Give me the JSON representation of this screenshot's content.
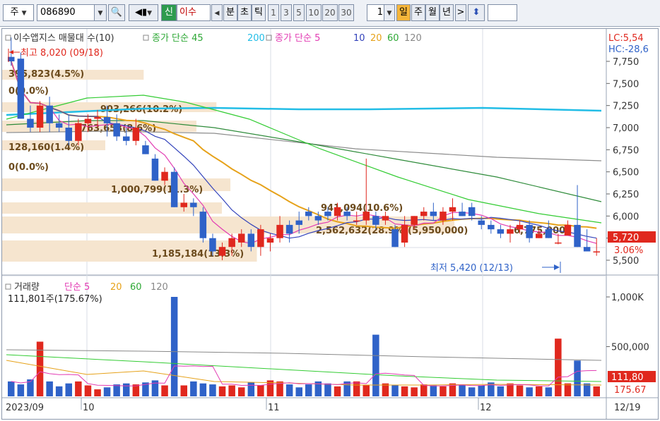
{
  "toolbar": {
    "market": "주",
    "code": "086890",
    "badge": "신",
    "name": "이수",
    "unit_min": "분",
    "unit_sec": "초",
    "unit_tick": "틱",
    "periods": [
      "1",
      "3",
      "5",
      "10",
      "20",
      "30"
    ],
    "count": "1",
    "day": "일",
    "week": "주",
    "month": "월",
    "year": "년",
    "next": ">",
    "updown": "⬍"
  },
  "price_legend": {
    "item1": "이수앱지스 매물대 수(10)",
    "item2": "종가 단순 45",
    "item2b": "200",
    "item3": "종가 단순 5",
    "mas": [
      "10",
      "20",
      "60",
      "120"
    ]
  },
  "right_top": {
    "lc": "LC:5,54",
    "hc": "HC:-28,6"
  },
  "price_axis": [
    "7,750",
    "7,500",
    "7,250",
    "7,000",
    "6,750",
    "6,500",
    "6,250",
    "6,000",
    "5,750",
    "5,500"
  ],
  "current_price": "5,720",
  "current_change": "3.06%",
  "annotations": {
    "high": "최고 8,020 (09/18)",
    "low": "최저 5,420 (12/13)"
  },
  "profile_labels": [
    "395,823(4.5%)",
    "0(0.0%)",
    "903,266(10.2%)",
    "763,653(8.6%)",
    "128,160(1.4%)",
    "0(0.0%)",
    "1,000,799(11.3%)",
    "941,094(10.6%)",
    "2,562,632(28.9%)(5,950,000)",
    "1,185,184(13.3%)",
    "6,775,000"
  ],
  "volume_legend": {
    "title": "거래량",
    "ma": "단순 5",
    "mas": [
      "20",
      "60",
      "120"
    ],
    "current": "111,801주(175.67%)"
  },
  "volume_axis": [
    "1,000K",
    "500,000"
  ],
  "volume_badge": {
    "value": "111,80",
    "pct": "175.67"
  },
  "date_axis": {
    "labels": [
      "2023/09",
      "10",
      "11",
      "12",
      "12/19"
    ]
  },
  "colors": {
    "up": "#e0281e",
    "down": "#2f62c8",
    "ma5": "#e23cb3",
    "ma10": "#3343bb",
    "ma20": "#e6a21a",
    "ma60": "#33cc33",
    "ma120": "#8c8c8c",
    "ma200": "#22bde6",
    "ma45": "#2e8b3a",
    "profile": "#f6e5cf"
  },
  "chart_data": {
    "type": "candlestick",
    "y_range": [
      5400,
      8050
    ],
    "volume_range": [
      0,
      1050000
    ],
    "dates": [
      "09/18",
      "09/19",
      "09/20",
      "09/21",
      "09/22",
      "09/25",
      "09/26",
      "09/27",
      "10/04",
      "10/05",
      "10/06",
      "10/10",
      "10/11",
      "10/12",
      "10/13",
      "10/16",
      "10/17",
      "10/18",
      "10/19",
      "10/20",
      "10/23",
      "10/24",
      "10/25",
      "10/26",
      "10/27",
      "10/30",
      "10/31",
      "11/01",
      "11/02",
      "11/03",
      "11/06",
      "11/07",
      "11/08",
      "11/09",
      "11/10",
      "11/13",
      "11/14",
      "11/15",
      "11/16",
      "11/17",
      "11/20",
      "11/21",
      "11/22",
      "11/23",
      "11/24",
      "11/27",
      "11/28",
      "11/29",
      "11/30",
      "12/01",
      "12/04",
      "12/05",
      "12/06",
      "12/07",
      "12/08",
      "12/11",
      "12/12",
      "12/13",
      "12/14",
      "12/15",
      "12/18",
      "12/19"
    ],
    "ohlc": [
      [
        7800,
        8020,
        7700,
        7750
      ],
      [
        7780,
        7850,
        7200,
        7100
      ],
      [
        7100,
        7250,
        6950,
        7000
      ],
      [
        7000,
        7300,
        6950,
        7250
      ],
      [
        7250,
        7350,
        6950,
        7050
      ],
      [
        7050,
        7150,
        6950,
        7000
      ],
      [
        7000,
        7150,
        6800,
        6850
      ],
      [
        6850,
        7100,
        6800,
        7050
      ],
      [
        7050,
        7150,
        6950,
        7100
      ],
      [
        7100,
        7200,
        7000,
        7120
      ],
      [
        7120,
        7250,
        6900,
        7050
      ],
      [
        7050,
        7150,
        6850,
        6900
      ],
      [
        6900,
        7000,
        6800,
        6850
      ],
      [
        6850,
        7100,
        6800,
        7000
      ],
      [
        6800,
        6850,
        6700,
        6700
      ],
      [
        6650,
        6700,
        6400,
        6400
      ],
      [
        6400,
        6550,
        6350,
        6500
      ],
      [
        6500,
        6550,
        6100,
        6100
      ],
      [
        6100,
        6250,
        6050,
        6150
      ],
      [
        6150,
        6200,
        6000,
        6100
      ],
      [
        6050,
        6100,
        5700,
        5750
      ],
      [
        5750,
        5800,
        5550,
        5600
      ],
      [
        5550,
        5700,
        5500,
        5650
      ],
      [
        5650,
        5800,
        5550,
        5750
      ],
      [
        5700,
        5850,
        5650,
        5800
      ],
      [
        5800,
        5850,
        5600,
        5650
      ],
      [
        5650,
        5900,
        5550,
        5850
      ],
      [
        5700,
        5800,
        5600,
        5750
      ],
      [
        5750,
        6000,
        5700,
        5900
      ],
      [
        5900,
        5950,
        5700,
        5800
      ],
      [
        5950,
        6050,
        5800,
        5900
      ],
      [
        6050,
        6100,
        5950,
        6000
      ],
      [
        6000,
        6050,
        5900,
        5950
      ],
      [
        6050,
        6100,
        5950,
        6000
      ],
      [
        6000,
        6150,
        5950,
        6100
      ],
      [
        6050,
        6100,
        5950,
        6000
      ],
      [
        5950,
        6050,
        5900,
        5950
      ],
      [
        5950,
        6650,
        5900,
        6050
      ],
      [
        6000,
        6050,
        5850,
        5900
      ],
      [
        5950,
        6050,
        5900,
        6000
      ],
      [
        5850,
        5900,
        5650,
        5650
      ],
      [
        5700,
        6000,
        5650,
        5900
      ],
      [
        5900,
        6000,
        5850,
        6000
      ],
      [
        6000,
        6100,
        5950,
        6050
      ],
      [
        6050,
        6150,
        5950,
        6000
      ],
      [
        5950,
        6100,
        5900,
        6050
      ],
      [
        6050,
        6200,
        5950,
        6100
      ],
      [
        6050,
        6150,
        6000,
        6000
      ],
      [
        6100,
        6150,
        5950,
        6000
      ],
      [
        5950,
        6000,
        5850,
        5900
      ],
      [
        5900,
        5950,
        5800,
        5850
      ],
      [
        5850,
        5900,
        5750,
        5800
      ],
      [
        5800,
        5900,
        5700,
        5850
      ],
      [
        5850,
        5950,
        5800,
        5900
      ],
      [
        5900,
        5950,
        5700,
        5750
      ],
      [
        5750,
        5850,
        5750,
        5800
      ],
      [
        5850,
        5950,
        5750,
        5750
      ],
      [
        5700,
        5800,
        5680,
        5700
      ],
      [
        5780,
        5950,
        5780,
        5900
      ],
      [
        5900,
        6350,
        5650,
        5650
      ],
      [
        5650,
        5850,
        5600,
        5600
      ],
      [
        5600,
        5750,
        5550,
        5600
      ]
    ],
    "volume": [
      150000,
      120000,
      170000,
      550000,
      150000,
      100000,
      130000,
      150000,
      110000,
      70000,
      90000,
      120000,
      130000,
      120000,
      140000,
      160000,
      110000,
      1000000,
      110000,
      150000,
      130000,
      120000,
      100000,
      110000,
      90000,
      140000,
      110000,
      160000,
      150000,
      120000,
      90000,
      120000,
      150000,
      130000,
      100000,
      150000,
      150000,
      110000,
      620000,
      130000,
      110000,
      100000,
      90000,
      120000,
      110000,
      100000,
      130000,
      110000,
      90000,
      110000,
      140000,
      100000,
      130000,
      110000,
      90000,
      100000,
      90000,
      580000,
      130000,
      360000,
      130000,
      100000
    ],
    "profile": [
      395823,
      0,
      903266,
      763653,
      128160,
      0,
      1000799,
      941094,
      2562632,
      1185184
    ],
    "profile_bins": [
      7900,
      7700,
      7450,
      7200,
      6950,
      6700,
      6450,
      5975,
      5900,
      5600
    ]
  }
}
